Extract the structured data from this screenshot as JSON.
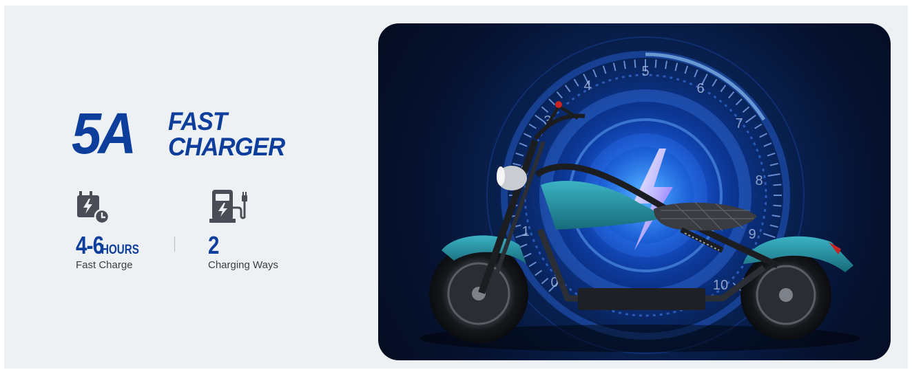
{
  "headline": {
    "big": "5A",
    "line1": "FAST",
    "line2": "CHARGER"
  },
  "features": [
    {
      "icon": "battery-clock-icon",
      "value": "4-6",
      "unit": "HOURS",
      "caption": "Fast Charge"
    },
    {
      "icon": "charging-station-icon",
      "value": "2",
      "unit": "",
      "caption": "Charging Ways"
    }
  ],
  "gauge": {
    "numbers": [
      "0",
      "1",
      "2",
      "3",
      "4",
      "5",
      "6",
      "7",
      "8",
      "9",
      "10"
    ]
  },
  "colors": {
    "brand_blue": "#0d3e9b",
    "background": "#edf1f4",
    "scooter_teal": "#1f8a9e"
  }
}
